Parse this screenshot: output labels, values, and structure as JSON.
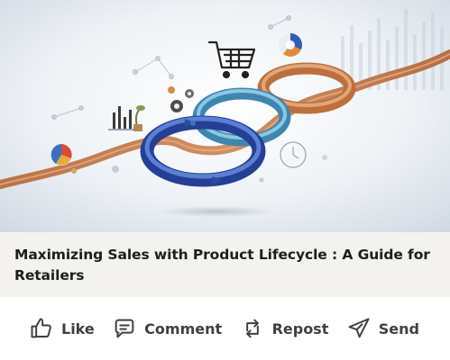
{
  "post": {
    "title": "Maximizing Sales with Product Lifecycle : A Guide for Retailers"
  },
  "actions": [
    {
      "label": "Like",
      "icon": "like-icon"
    },
    {
      "label": "Comment",
      "icon": "comment-icon"
    },
    {
      "label": "Repost",
      "icon": "repost-icon"
    },
    {
      "label": "Send",
      "icon": "send-icon"
    }
  ],
  "colors": {
    "title_band": "#f3f2ef",
    "action_text": "#404040",
    "ring_blue_dark": "#2f4fa8",
    "ring_teal": "#4f9ec4",
    "ring_copper": "#c87a45"
  }
}
